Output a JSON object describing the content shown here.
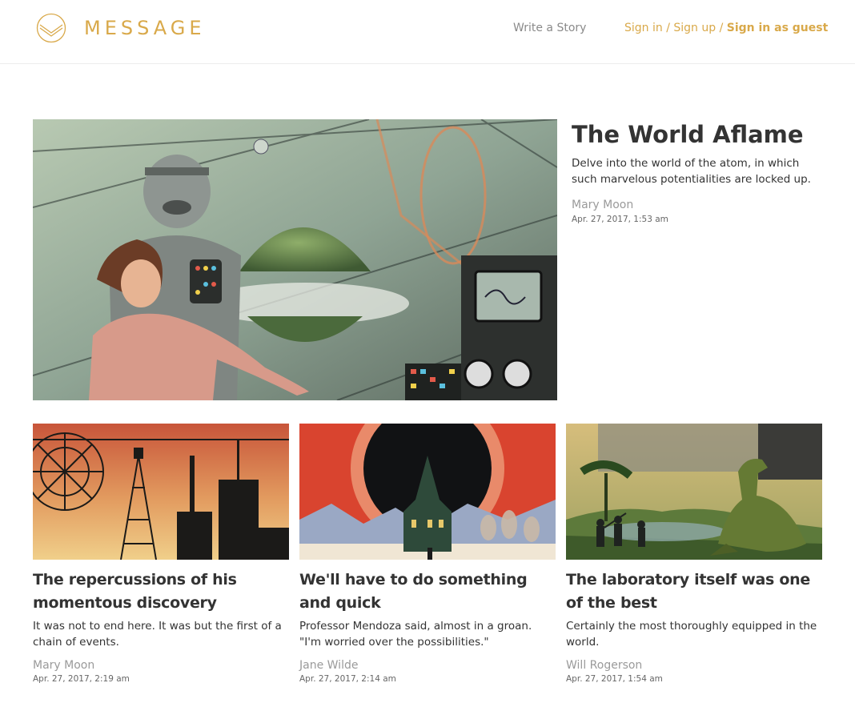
{
  "header": {
    "brand": "MESSAGE",
    "write_label": "Write a Story",
    "sign_in": "Sign in",
    "sep1": " / ",
    "sign_up": "Sign up",
    "sep2": " / ",
    "guest": "Sign in as guest"
  },
  "colors": {
    "accent": "#d9a94a",
    "muted": "#9a9a9a",
    "text": "#333333"
  },
  "featured": {
    "title": "The World Aflame",
    "excerpt": "Delve into the world of the atom, in which such marvelous potentialities are locked up.",
    "author": "Mary Moon",
    "date": "Apr. 27, 2017, 1:53 am",
    "image": "retro-robot-and-woman-illustration"
  },
  "stories": [
    {
      "title": "The repercussions of his momentous discovery",
      "excerpt": "It was not to end here. It was but the first of a chain of events.",
      "author": "Mary Moon",
      "date": "Apr. 27, 2017, 2:19 am",
      "image": "radar-towers-illustration"
    },
    {
      "title": "We'll have to do something and quick",
      "excerpt": "Professor Mendoza said, almost in a groan. \"I'm worried over the possibilities.\"",
      "author": "Jane Wilde",
      "date": "Apr. 27, 2017, 2:14 am",
      "image": "eclipse-church-illustration"
    },
    {
      "title": "The laboratory itself was one of the best",
      "excerpt": "Certainly the most thoroughly equipped in the world.",
      "author": "Will Rogerson",
      "date": "Apr. 27, 2017, 1:54 am",
      "image": "dinosaur-hunters-illustration"
    }
  ]
}
